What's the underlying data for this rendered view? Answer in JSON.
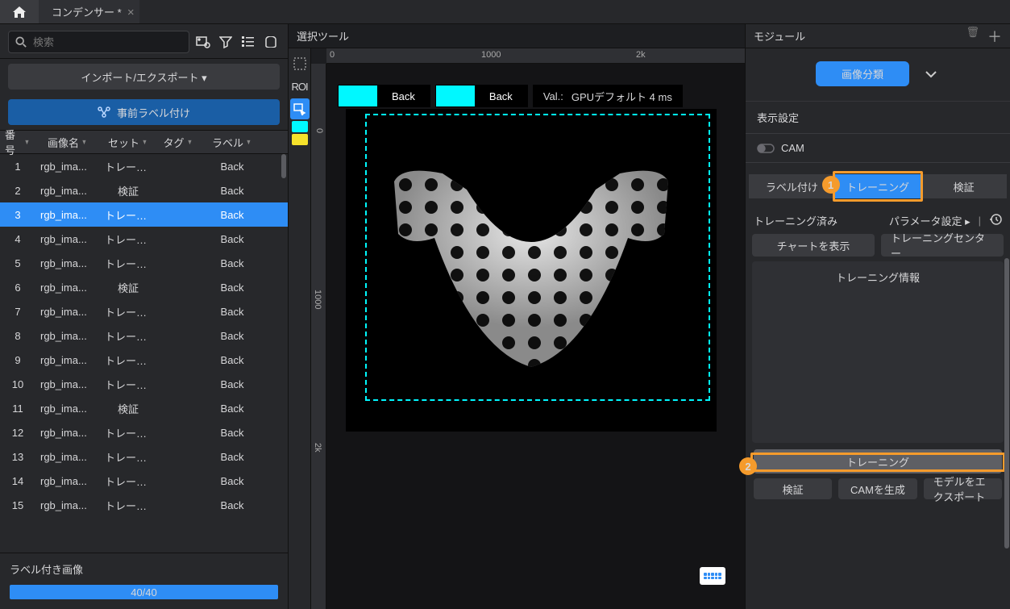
{
  "titlebar": {
    "tab_title": "コンデンサー *"
  },
  "left": {
    "search_placeholder": "検索",
    "import_export": "インポート/エクスポート ▾",
    "pre_label": "事前ラベル付け",
    "columns": {
      "no": "番号",
      "name": "画像名",
      "set": "セット",
      "tag": "タグ",
      "label": "ラベル"
    },
    "rows": [
      {
        "no": 1,
        "name": "rgb_ima...",
        "set": "トレーニ...",
        "label": "Back",
        "sel": false
      },
      {
        "no": 2,
        "name": "rgb_ima...",
        "set": "検証",
        "label": "Back",
        "sel": false
      },
      {
        "no": 3,
        "name": "rgb_ima...",
        "set": "トレーニ...",
        "label": "Back",
        "sel": true
      },
      {
        "no": 4,
        "name": "rgb_ima...",
        "set": "トレーニ...",
        "label": "Back",
        "sel": false
      },
      {
        "no": 5,
        "name": "rgb_ima...",
        "set": "トレーニ...",
        "label": "Back",
        "sel": false
      },
      {
        "no": 6,
        "name": "rgb_ima...",
        "set": "検証",
        "label": "Back",
        "sel": false
      },
      {
        "no": 7,
        "name": "rgb_ima...",
        "set": "トレーニ...",
        "label": "Back",
        "sel": false
      },
      {
        "no": 8,
        "name": "rgb_ima...",
        "set": "トレーニ...",
        "label": "Back",
        "sel": false
      },
      {
        "no": 9,
        "name": "rgb_ima...",
        "set": "トレーニ...",
        "label": "Back",
        "sel": false
      },
      {
        "no": 10,
        "name": "rgb_ima...",
        "set": "トレーニ...",
        "label": "Back",
        "sel": false
      },
      {
        "no": 11,
        "name": "rgb_ima...",
        "set": "検証",
        "label": "Back",
        "sel": false
      },
      {
        "no": 12,
        "name": "rgb_ima...",
        "set": "トレーニ...",
        "label": "Back",
        "sel": false
      },
      {
        "no": 13,
        "name": "rgb_ima...",
        "set": "トレーニ...",
        "label": "Back",
        "sel": false
      },
      {
        "no": 14,
        "name": "rgb_ima...",
        "set": "トレーニ...",
        "label": "Back",
        "sel": false
      },
      {
        "no": 15,
        "name": "rgb_ima...",
        "set": "トレーニ...",
        "label": "Back",
        "sel": false
      }
    ],
    "footer": {
      "title": "ラベル付き画像",
      "progress": "40/40"
    }
  },
  "center": {
    "title": "選択ツール",
    "ruler": {
      "t0": "0",
      "t1": "1000",
      "t2": "2k",
      "v0": "0",
      "v1": "1000",
      "v2": "2k"
    },
    "tools": {
      "roi": "ROI"
    },
    "overlay": {
      "label1": "Back",
      "label2": "Back",
      "val": "Val.:",
      "gpu": "GPUデフォルト 4 ms"
    }
  },
  "right": {
    "panel_title": "モジュール",
    "module": "画像分類",
    "display_settings": "表示設定",
    "cam": "CAM",
    "tabs": {
      "label": "ラベル付け",
      "train": "トレーニング",
      "verify": "検証"
    },
    "status": {
      "trained": "トレーニング済み",
      "params": "パラメータ設定"
    },
    "btns": {
      "show_chart": "チャートを表示",
      "train_center": "トレーニングセンター"
    },
    "info_title": "トレーニング情報",
    "train_button": "トレーニング",
    "bottom": {
      "verify": "検証",
      "gen_cam": "CAMを生成",
      "export": "モデルをエクスポート"
    },
    "badges": {
      "one": "1",
      "two": "2"
    }
  }
}
